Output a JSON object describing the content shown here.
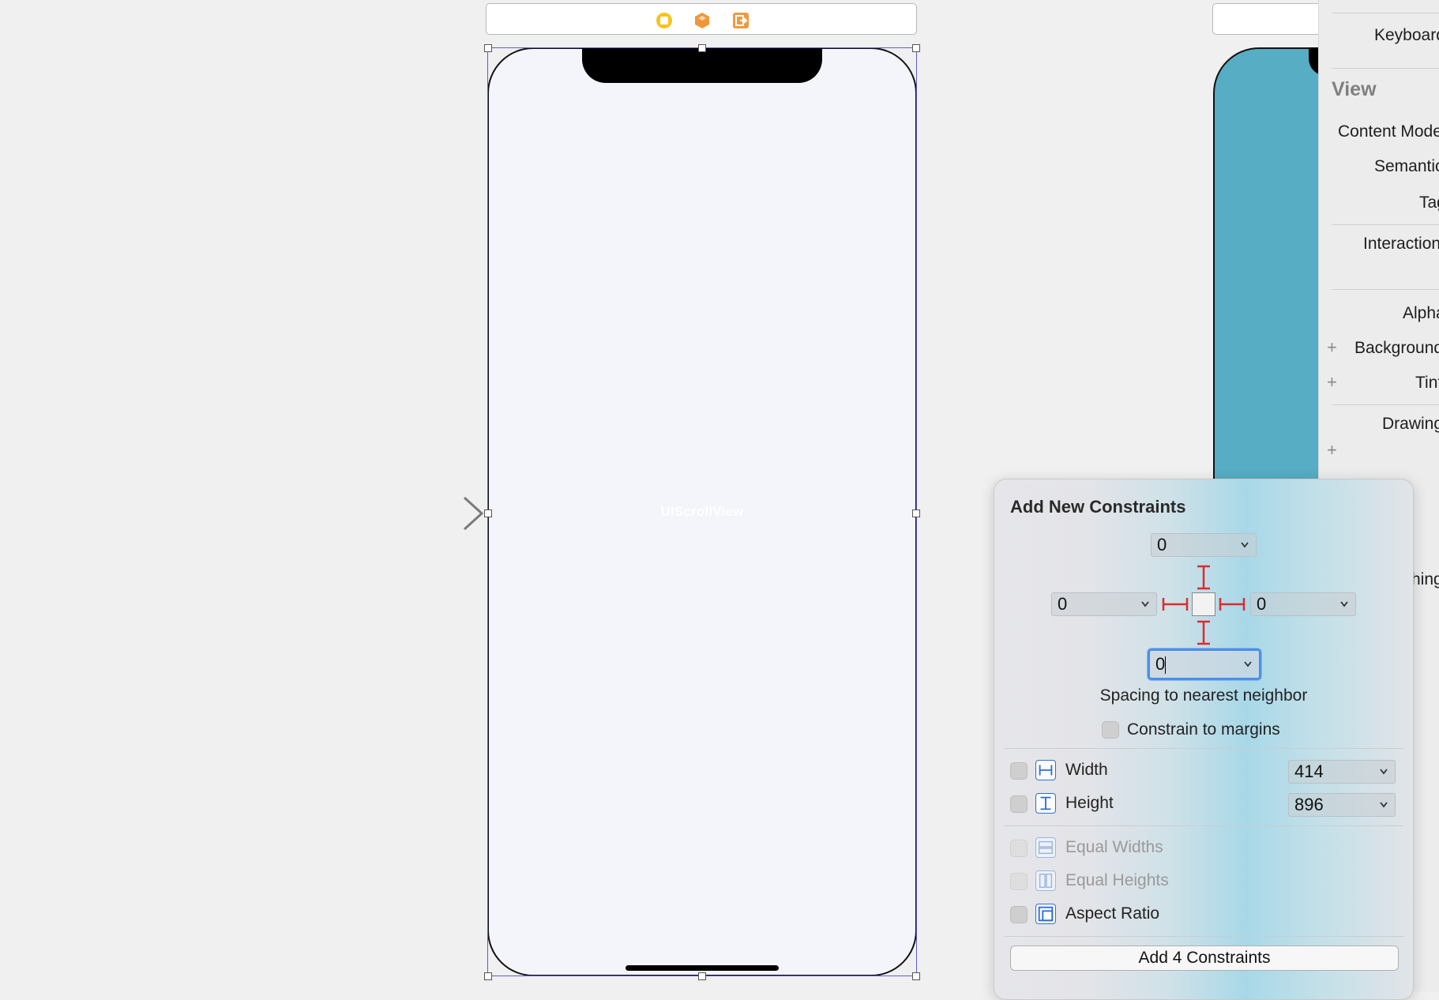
{
  "canvas": {
    "scene": {
      "dock_icons": [
        "view-controller-icon",
        "first-responder-icon",
        "exit-icon"
      ],
      "scroll_view_label": "UIScrollView"
    },
    "second_scene": {
      "background_color": "#56adc4"
    }
  },
  "inspector": {
    "rows_top": [
      "Keyboard"
    ],
    "section_header": "View",
    "rows": [
      {
        "label": "Content Mode",
        "has_plus": false
      },
      {
        "label": "Semantic",
        "has_plus": false
      },
      {
        "label": "Tag",
        "has_plus": false
      },
      {
        "label": "Interaction",
        "has_plus": false
      },
      {
        "label": "Alpha",
        "has_plus": false
      },
      {
        "label": "Background",
        "has_plus": true
      },
      {
        "label": "Tint",
        "has_plus": true
      },
      {
        "label": "Drawing",
        "has_plus": false
      }
    ],
    "partial_label": "hing"
  },
  "constraints_popover": {
    "title": "Add New Constraints",
    "top_value": "0",
    "leading_value": "0",
    "trailing_value": "0",
    "bottom_value": "0",
    "spacing_caption": "Spacing to nearest neighbor",
    "constrain_to_margins": {
      "label": "Constrain to margins",
      "checked": false
    },
    "options": [
      {
        "label": "Width",
        "value": "414",
        "checked": false,
        "enabled": true
      },
      {
        "label": "Height",
        "value": "896",
        "checked": false,
        "enabled": true
      },
      {
        "label": "Equal Widths",
        "checked": false,
        "enabled": false
      },
      {
        "label": "Equal Heights",
        "checked": false,
        "enabled": false
      },
      {
        "label": "Aspect Ratio",
        "checked": false,
        "enabled": true
      }
    ],
    "add_button_label": "Add 4 Constraints",
    "strut_color": "#e02a2a",
    "accent_color": "#2d6fd6"
  }
}
